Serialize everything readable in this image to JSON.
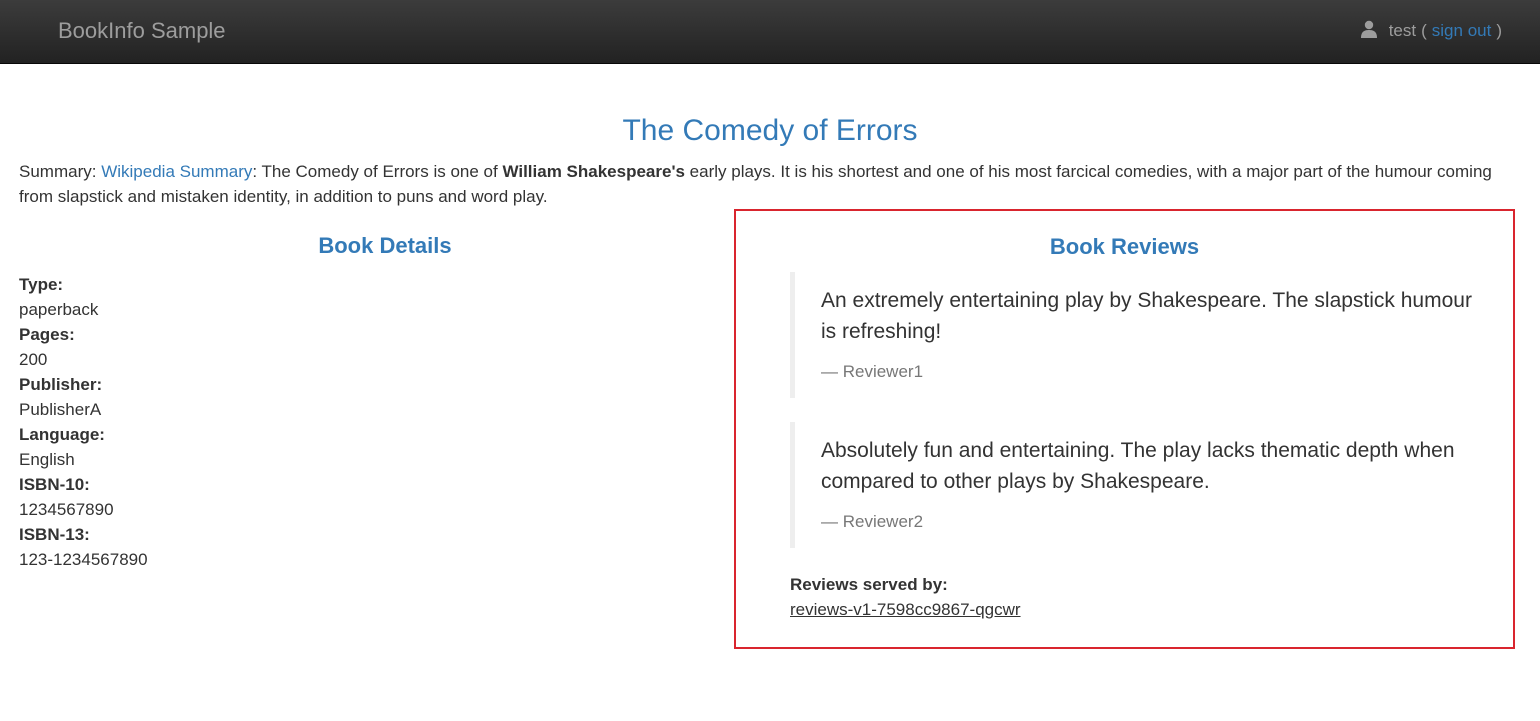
{
  "navbar": {
    "brand": "BookInfo Sample",
    "user": "test",
    "paren_open": "(",
    "sign_out": "sign out",
    "paren_close": ")"
  },
  "book": {
    "title": "The Comedy of Errors",
    "summary_label": "Summary:",
    "summary_link": "Wikipedia Summary",
    "summary_pre": ": The Comedy of Errors is one of",
    "summary_bold": "William Shakespeare's",
    "summary_post": "early plays. It is his shortest and one of his most farcical comedies, with a major part of the humour coming from slapstick and mistaken identity, in addition to puns and word play."
  },
  "details": {
    "heading": "Book Details",
    "fields": [
      {
        "label": "Type:",
        "value": "paperback"
      },
      {
        "label": "Pages:",
        "value": "200"
      },
      {
        "label": "Publisher:",
        "value": "PublisherA"
      },
      {
        "label": "Language:",
        "value": "English"
      },
      {
        "label": "ISBN-10:",
        "value": "1234567890"
      },
      {
        "label": "ISBN-13:",
        "value": "123-1234567890"
      }
    ]
  },
  "reviews": {
    "heading": "Book Reviews",
    "items": [
      {
        "text": "An extremely entertaining play by Shakespeare. The slapstick humour is refreshing!",
        "author": "— Reviewer1"
      },
      {
        "text": "Absolutely fun and entertaining. The play lacks thematic depth when compared to other plays by Shakespeare.",
        "author": "— Reviewer2"
      }
    ],
    "served_label": "Reviews served by:",
    "served_value": "reviews-v1-7598cc9867-qgcwr"
  },
  "icons": {
    "user": "user-icon"
  },
  "colors": {
    "link": "#337ab7",
    "highlight_border": "#d9252e",
    "navbar": "#222222"
  }
}
